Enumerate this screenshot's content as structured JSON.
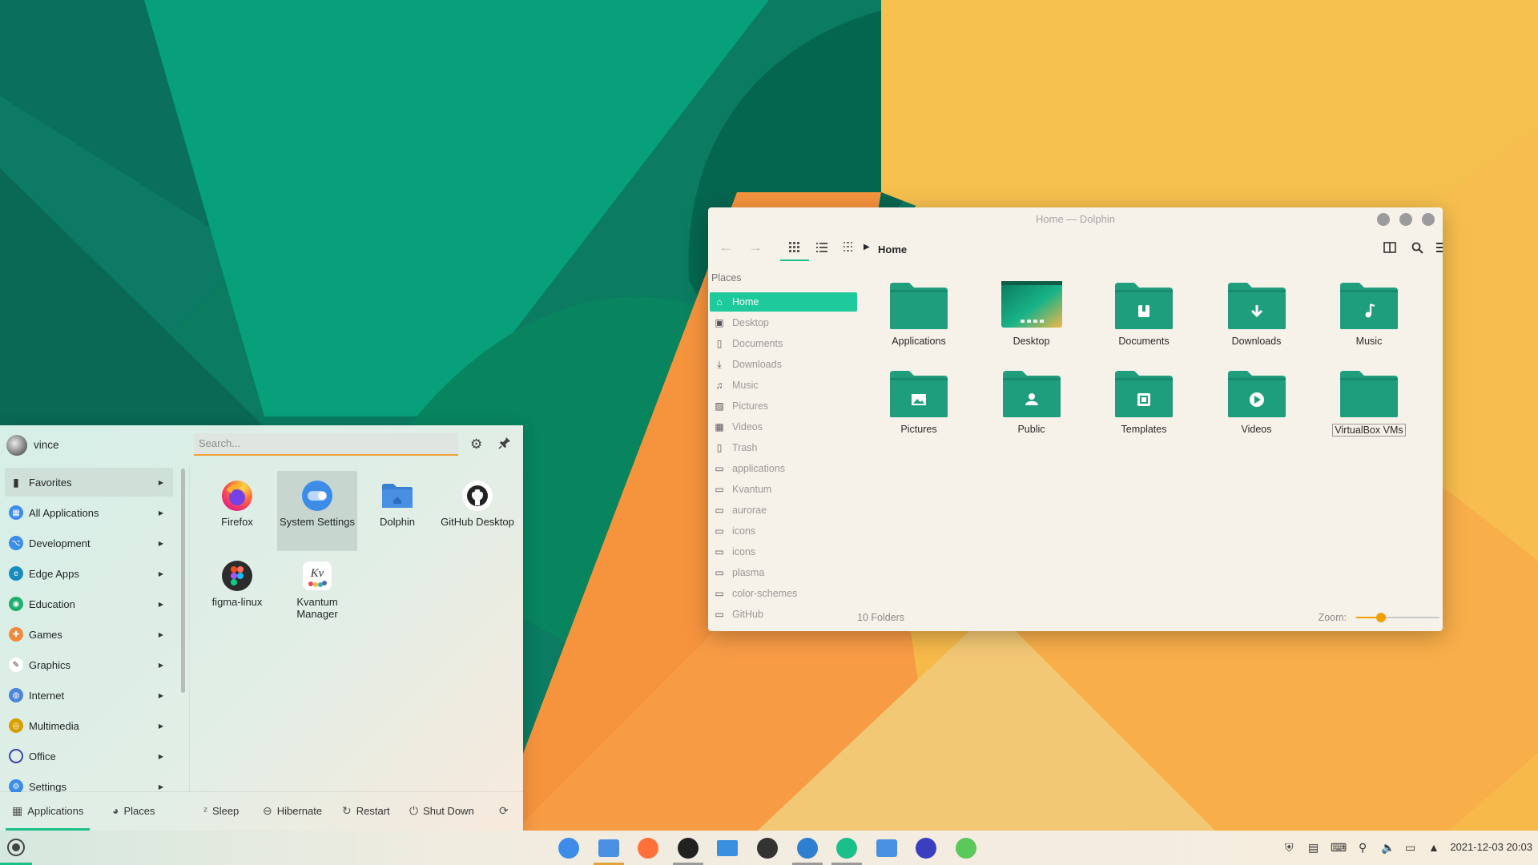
{
  "dolphin": {
    "title": "Home — Dolphin",
    "breadcrumb": "Home",
    "places_header": "Places",
    "places": [
      {
        "label": "Home",
        "icon": "home-icon",
        "selected": true
      },
      {
        "label": "Desktop",
        "icon": "desktop-icon"
      },
      {
        "label": "Documents",
        "icon": "document-icon"
      },
      {
        "label": "Downloads",
        "icon": "download-icon"
      },
      {
        "label": "Music",
        "icon": "music-icon"
      },
      {
        "label": "Pictures",
        "icon": "picture-icon"
      },
      {
        "label": "Videos",
        "icon": "video-icon"
      },
      {
        "label": "Trash",
        "icon": "trash-icon"
      },
      {
        "label": "applications",
        "icon": "folder-icon"
      },
      {
        "label": "Kvantum",
        "icon": "folder-icon"
      },
      {
        "label": "aurorae",
        "icon": "folder-icon"
      },
      {
        "label": "icons",
        "icon": "folder-icon"
      },
      {
        "label": "icons",
        "icon": "folder-icon"
      },
      {
        "label": "plasma",
        "icon": "folder-icon"
      },
      {
        "label": "color-schemes",
        "icon": "folder-icon"
      },
      {
        "label": "GitHub",
        "icon": "folder-icon"
      }
    ],
    "folders": [
      {
        "label": "Applications",
        "emblem": ""
      },
      {
        "label": "Desktop",
        "emblem": "desktop"
      },
      {
        "label": "Documents",
        "emblem": "document"
      },
      {
        "label": "Downloads",
        "emblem": "download"
      },
      {
        "label": "Music",
        "emblem": "music"
      },
      {
        "label": "Pictures",
        "emblem": "picture"
      },
      {
        "label": "Public",
        "emblem": "person"
      },
      {
        "label": "Templates",
        "emblem": "template"
      },
      {
        "label": "Videos",
        "emblem": "play"
      },
      {
        "label": "VirtualBox VMs",
        "emblem": "",
        "focused": true
      }
    ],
    "status": "10 Folders",
    "zoom_label": "Zoom:",
    "zoom_level": 0.3,
    "accent": "#1ec99b",
    "folder_color": "#1f9e7e"
  },
  "launcher": {
    "user": "vince",
    "search_placeholder": "Search...",
    "categories": [
      {
        "label": "Favorites",
        "icon": "bookmark-icon",
        "color": "#333333",
        "selected": true
      },
      {
        "label": "All Applications",
        "icon": "grid-icon",
        "color": "#3d8de8"
      },
      {
        "label": "Development",
        "icon": "code-icon",
        "color": "#3d8de8"
      },
      {
        "label": "Edge Apps",
        "icon": "edge-icon",
        "color": "#1a8bbd"
      },
      {
        "label": "Education",
        "icon": "education-icon",
        "color": "#1dae6e"
      },
      {
        "label": "Games",
        "icon": "gamepad-icon",
        "color": "#f08a40"
      },
      {
        "label": "Graphics",
        "icon": "pen-icon",
        "color": "#ffffff"
      },
      {
        "label": "Internet",
        "icon": "globe-icon",
        "color": "#4d86d8"
      },
      {
        "label": "Multimedia",
        "icon": "multimedia-icon",
        "color": "#d7a000"
      },
      {
        "label": "Office",
        "icon": "office-icon",
        "color": "#3b3fbf"
      },
      {
        "label": "Settings",
        "icon": "settings-icon",
        "color": "#3d8de8"
      }
    ],
    "apps": [
      {
        "label": "Firefox",
        "icon": "firefox-icon",
        "color": "#ff7139"
      },
      {
        "label": "System Settings",
        "icon": "settings-toggle-icon",
        "color": "#3d8de8",
        "selected": true
      },
      {
        "label": "Dolphin",
        "icon": "dolphin-folder-icon",
        "color": "#4a90e2"
      },
      {
        "label": "GitHub Desktop",
        "icon": "github-icon",
        "color": "#ffffff"
      },
      {
        "label": "figma-linux",
        "icon": "figma-icon",
        "color": "#2c2c2c"
      },
      {
        "label": "Kvantum Manager",
        "icon": "kvantum-icon",
        "color": "#ffffff"
      }
    ],
    "footer": {
      "applications": "Applications",
      "places": "Places",
      "sleep": "Sleep",
      "hibernate": "Hibernate",
      "restart": "Restart",
      "shutdown": "Shut Down"
    }
  },
  "taskbar": {
    "apps": [
      {
        "name": "system-settings-task",
        "color": "#3d8de8"
      },
      {
        "name": "dolphin-task",
        "color": "#4a90e2",
        "active": true
      },
      {
        "name": "firefox-task",
        "color": "#ff7139"
      },
      {
        "name": "github-task",
        "color": "#222222",
        "running": true
      },
      {
        "name": "mail-task",
        "color": "#3a8fe0"
      },
      {
        "name": "inkscape-task",
        "color": "#333333"
      },
      {
        "name": "software-center-task",
        "color": "#2f7fd1",
        "running": true
      },
      {
        "name": "music-player-task",
        "color": "#1bbf8a",
        "running": true
      },
      {
        "name": "files-task",
        "color": "#4a90e2"
      },
      {
        "name": "system-monitor-task",
        "color": "#3b3fbf"
      },
      {
        "name": "android-task",
        "color": "#5ac85a"
      }
    ],
    "clock": "2021-12-03 20:03"
  }
}
